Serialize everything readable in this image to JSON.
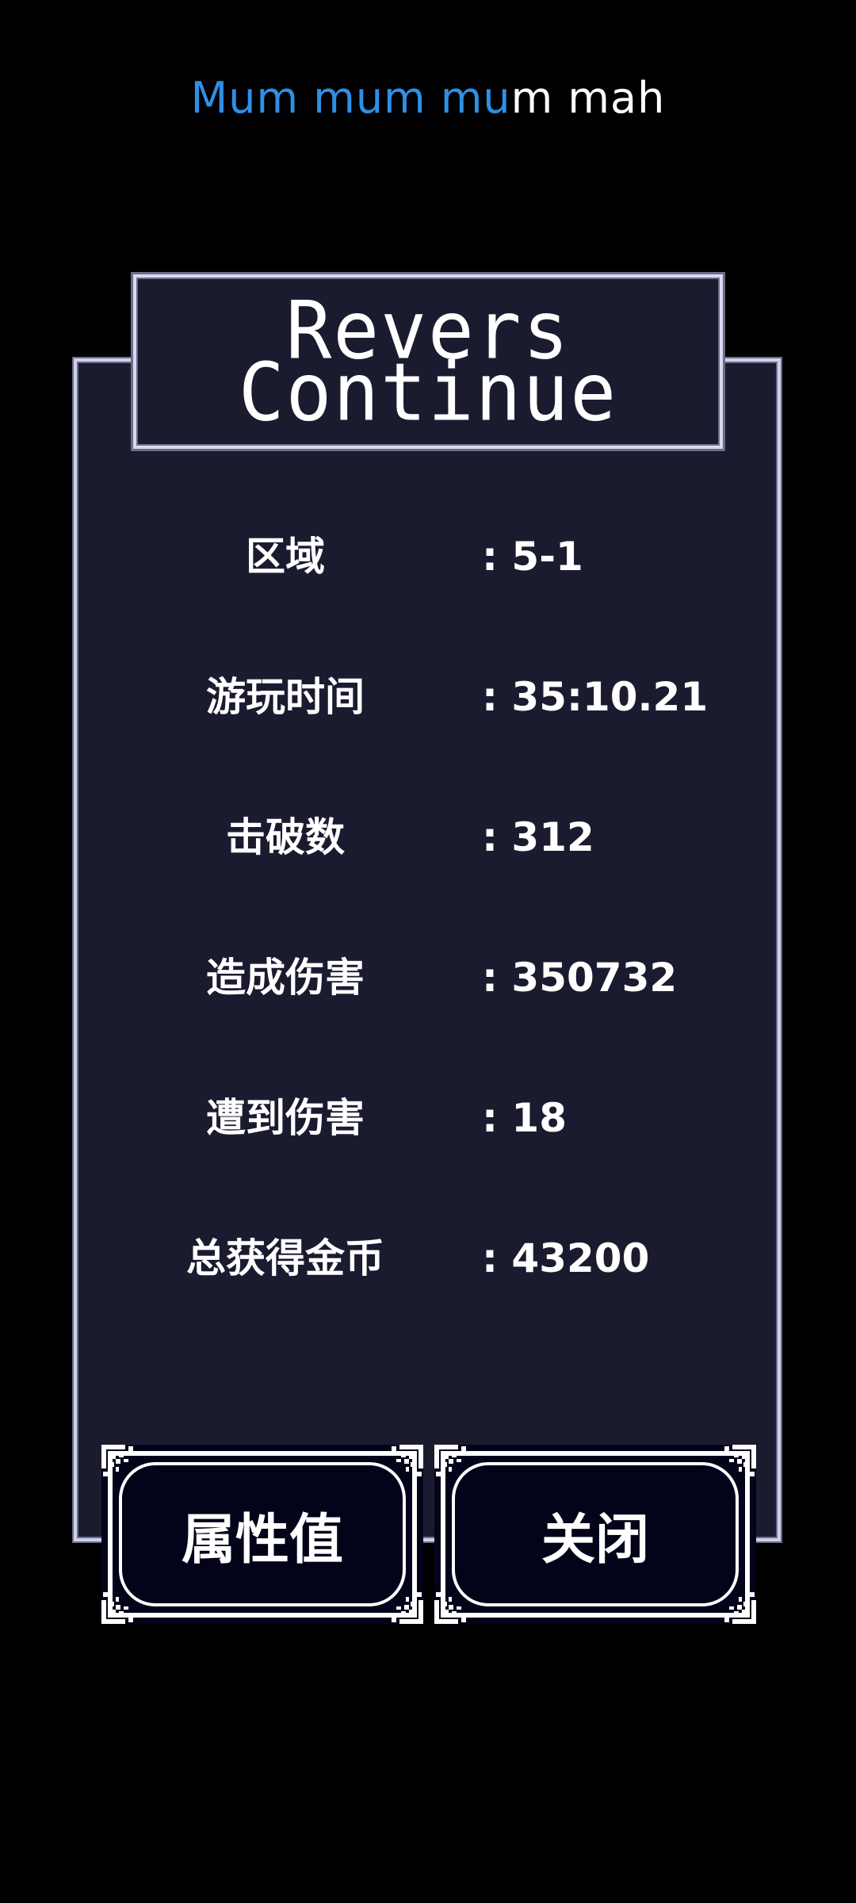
{
  "banner": {
    "highlighted": "Mum mum mu",
    "rest": "m mah",
    "highlight_color": "#2f8fe6"
  },
  "title": {
    "line1": "Revers",
    "line2": "Continue"
  },
  "stats": [
    {
      "label": "区域",
      "value": ": 5-1"
    },
    {
      "label": "游玩时间",
      "value": ": 35:10.21"
    },
    {
      "label": "击破数",
      "value": ": 312"
    },
    {
      "label": "造成伤害",
      "value": ": 350732"
    },
    {
      "label": "遭到伤害",
      "value": ": 18"
    },
    {
      "label": "总获得金币",
      "value": ": 43200"
    }
  ],
  "buttons": {
    "attributes": "属性值",
    "close": "关闭"
  },
  "colors": {
    "background": "#000000",
    "panel": "#1b1b30",
    "panel_border": "#cfd0ea",
    "button_fill": "#03031a"
  }
}
